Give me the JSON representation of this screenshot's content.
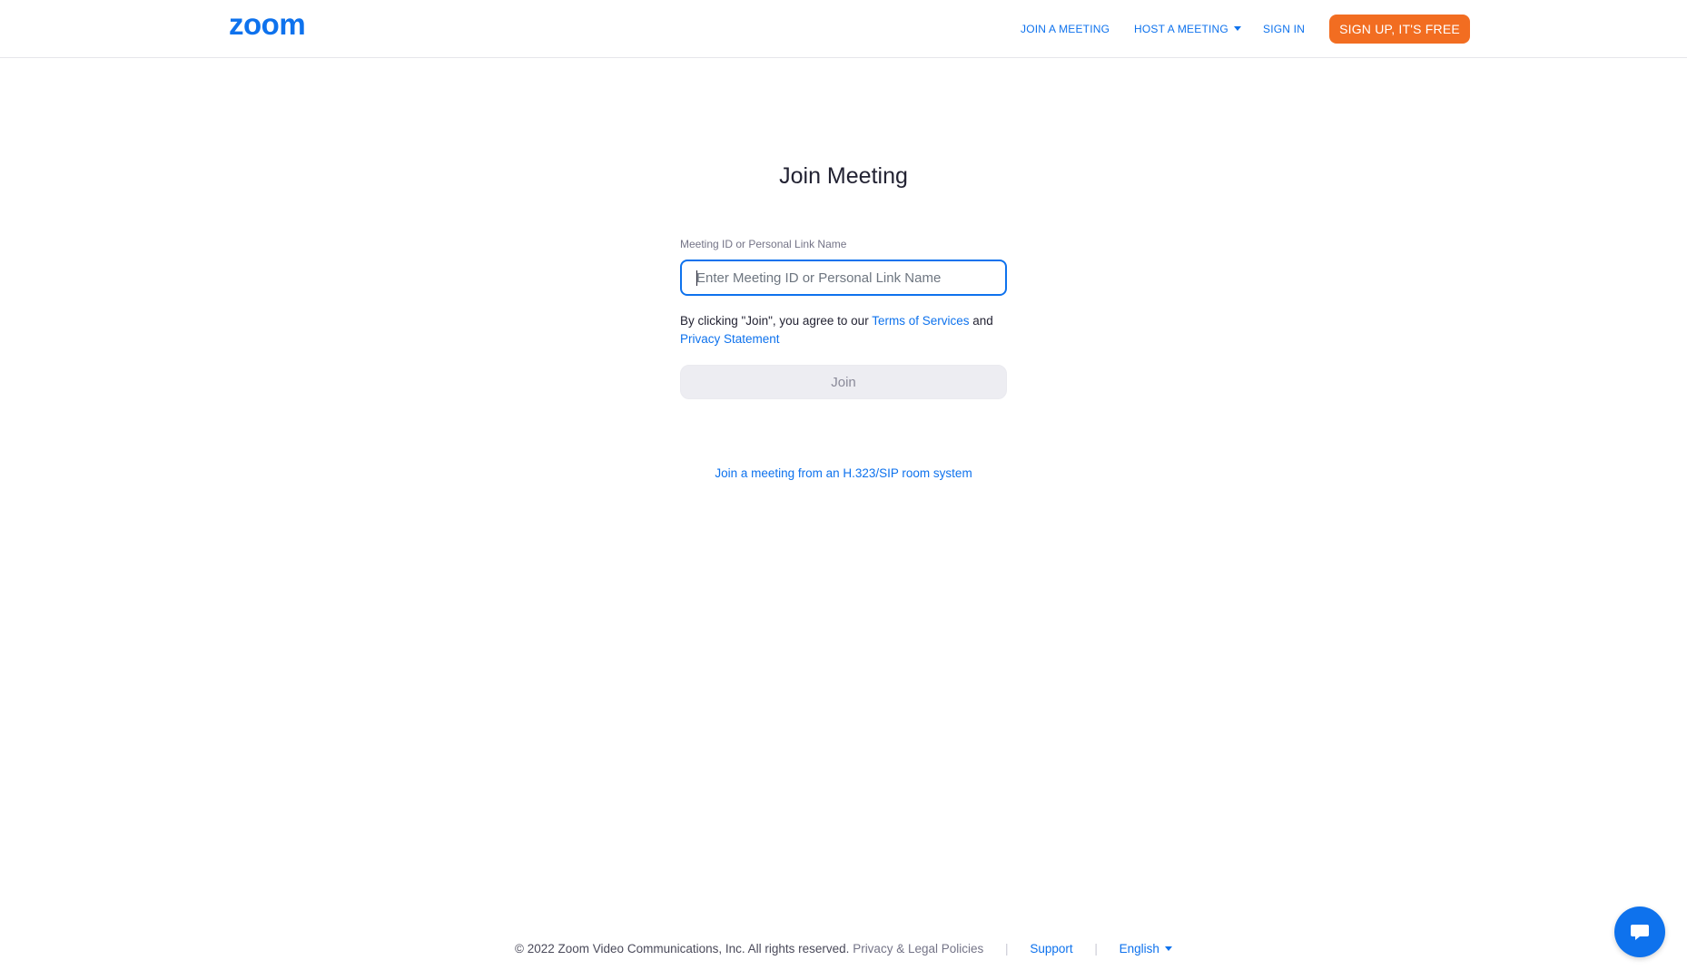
{
  "header": {
    "logo_text": "zoom",
    "nav": {
      "join_meeting": "JOIN A MEETING",
      "host_meeting": "HOST A MEETING",
      "sign_in": "SIGN IN"
    },
    "signup_label": "SIGN UP, IT'S FREE"
  },
  "main": {
    "title": "Join Meeting",
    "field_label": "Meeting ID or Personal Link Name",
    "input_placeholder": "Enter Meeting ID or Personal Link Name",
    "input_value": "",
    "terms_prefix": "By clicking \"Join\", you agree to our ",
    "terms_link": "Terms of Services",
    "terms_and": " and",
    "privacy_link": "Privacy Statement",
    "join_button": "Join",
    "sip_link": "Join a meeting from an H.323/SIP room system"
  },
  "footer": {
    "copyright": "© 2022 Zoom Video Communications, Inc. All rights reserved.",
    "legal": "Privacy & Legal Policies",
    "separator": "|",
    "support": "Support",
    "language": "English"
  },
  "icons": {
    "chat": "chat-bubble-icon",
    "caret": "caret-down-icon"
  },
  "colors": {
    "brand_blue": "#0e72ed",
    "signup_orange": "#f26d21",
    "disabled_button_bg": "#ededf2"
  }
}
